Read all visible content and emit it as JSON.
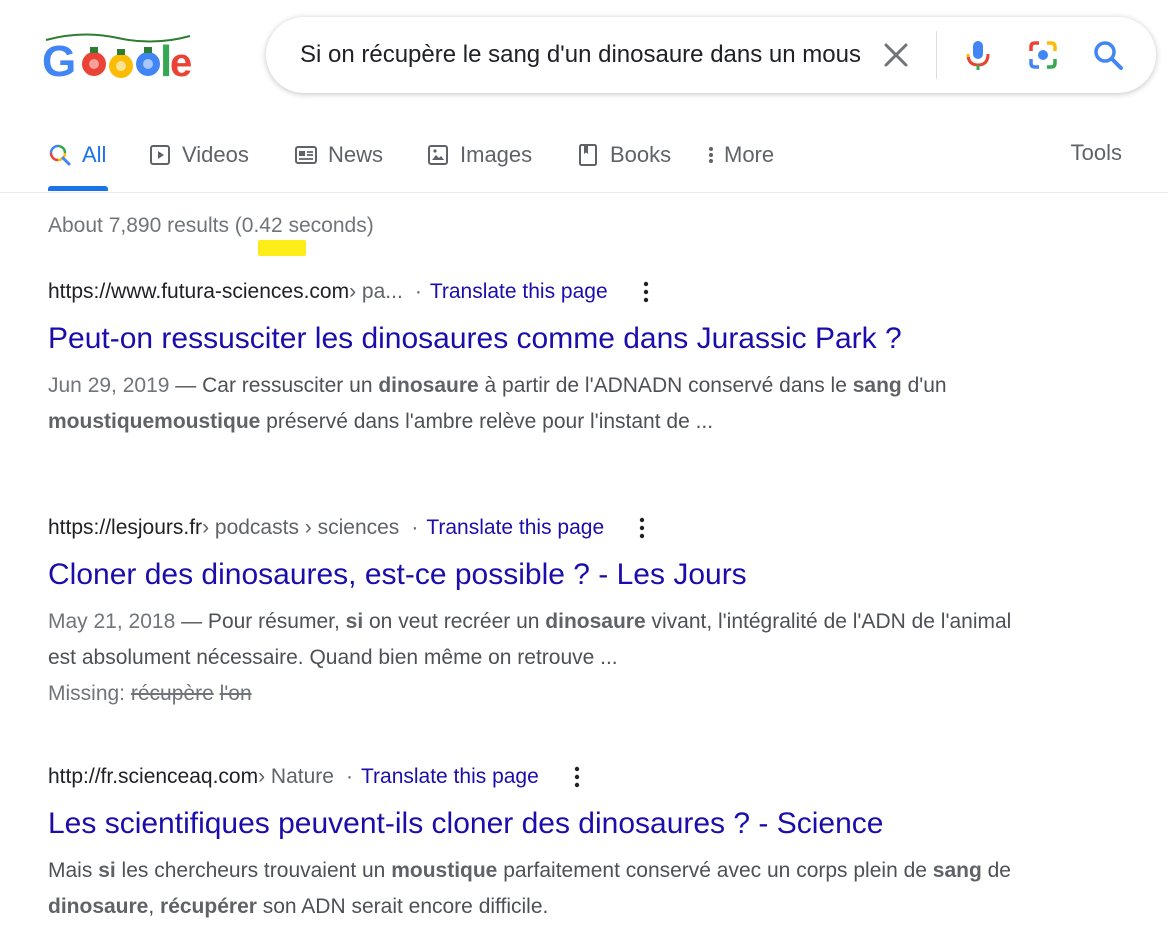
{
  "logo": {
    "text": "Google",
    "variant": "holiday string-lights doodle"
  },
  "search": {
    "query": "Si on récupère le sang d'un dinosaure dans un moustique",
    "clear_icon": "close-icon",
    "voice_icon": "microphone-icon",
    "lens_icon": "camera-lens-icon",
    "submit_icon": "search-icon"
  },
  "tabs": [
    {
      "label": "All",
      "icon": "search-icon",
      "active": true
    },
    {
      "label": "Videos",
      "icon": "play-icon"
    },
    {
      "label": "News",
      "icon": "newspaper-icon"
    },
    {
      "label": "Images",
      "icon": "image-icon"
    },
    {
      "label": "Books",
      "icon": "book-icon"
    },
    {
      "label": "More",
      "icon": "vertical-dots-icon"
    }
  ],
  "tools_label": "Tools",
  "stats": {
    "prefix": "About 7,890 results (",
    "time": "0.42",
    "suffix": " seconds)"
  },
  "results": [
    {
      "site": "https://www.futura-sciences.com",
      "path": " › pa...",
      "translate": "Translate this page",
      "title": "Peut-on ressusciter les dinosaures comme dans Jurassic Park ?",
      "date": "Jun 29, 2019",
      "snippet_parts": [
        {
          "t": " — Car ressusciter un ",
          "b": false
        },
        {
          "t": "dinosaure",
          "b": true
        },
        {
          "t": " à partir de l'ADNADN conservé dans le ",
          "b": false
        },
        {
          "t": "sang",
          "b": true
        },
        {
          "t": " d'un ",
          "b": false
        },
        {
          "t": "moustiquemoustique",
          "b": true
        },
        {
          "t": " préservé dans l'ambre relève pour l'instant de ...",
          "b": false
        }
      ]
    },
    {
      "site": "https://lesjours.fr",
      "path": " › podcasts › sciences",
      "translate": "Translate this page",
      "title": "Cloner des dinosaures, est-ce possible ? - Les Jours",
      "date": "May 21, 2018",
      "snippet_parts": [
        {
          "t": " — Pour résumer, ",
          "b": false
        },
        {
          "t": "si",
          "b": true
        },
        {
          "t": " on veut recréer un ",
          "b": false
        },
        {
          "t": "dinosaure",
          "b": true
        },
        {
          "t": " vivant, l'intégralité de l'ADN de l'animal est absolument nécessaire. Quand bien même on retrouve ...",
          "b": false
        }
      ],
      "missing_label": "Missing: ",
      "missing_terms": [
        "récupère",
        "l'on"
      ]
    },
    {
      "site": "http://fr.scienceaq.com",
      "path": " › Nature",
      "translate": "Translate this page",
      "title": "Les scientifiques peuvent-ils cloner des dinosaures ? - Science",
      "snippet_parts": [
        {
          "t": "Mais ",
          "b": false
        },
        {
          "t": "si",
          "b": true
        },
        {
          "t": " les chercheurs trouvaient un ",
          "b": false
        },
        {
          "t": "moustique",
          "b": true
        },
        {
          "t": " parfaitement conservé avec un corps plein de ",
          "b": false
        },
        {
          "t": "sang",
          "b": true
        },
        {
          "t": " de ",
          "b": false
        },
        {
          "t": "dinosaure",
          "b": true
        },
        {
          "t": ", ",
          "b": false
        },
        {
          "t": "récupérer",
          "b": true
        },
        {
          "t": " son ADN serait encore difficile.",
          "b": false
        }
      ]
    }
  ],
  "colors": {
    "link": "#1a0dab",
    "accent": "#1a73e8",
    "annotation_highlight": "#ffeb00"
  }
}
